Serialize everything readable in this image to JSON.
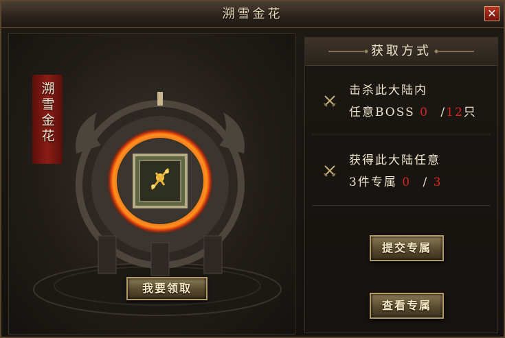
{
  "window": {
    "title": "溯雪金花",
    "close_glyph": "✕"
  },
  "item": {
    "name_vertical": "溯雪金花",
    "claim_label": "我要领取"
  },
  "acquire": {
    "title": "获取方式",
    "tasks": [
      {
        "line1": "击杀此大陆内",
        "prefix": "任意BOSS",
        "current": "0",
        "separator": "/",
        "target": "12",
        "suffix": "只"
      },
      {
        "line1": "获得此大陆任意",
        "prefix": "3件专属",
        "current": "0",
        "separator": "/",
        "target": "3",
        "suffix": ""
      }
    ],
    "submit_label": "提交专属",
    "view_label": "查看专属"
  },
  "icons": {
    "close": "close-icon",
    "task": "crossed-swords-icon",
    "item": "golden-flower-icon"
  },
  "colors": {
    "accent_red": "#e0241a",
    "fire_ring": "#ff8a1e",
    "button_border": "#b39a62"
  }
}
